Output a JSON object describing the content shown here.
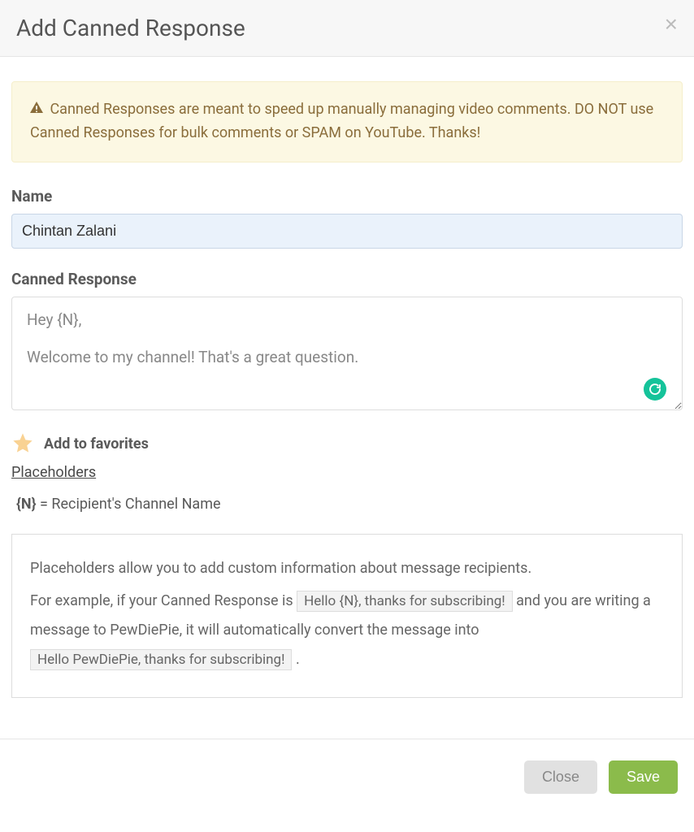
{
  "modal": {
    "title": "Add Canned Response"
  },
  "alert": {
    "text": "Canned Responses are meant to speed up manually managing video comments. DO NOT use Canned Responses for bulk comments or SPAM on YouTube. Thanks!"
  },
  "form": {
    "name_label": "Name",
    "name_value": "Chintan Zalani",
    "response_label": "Canned Response",
    "response_value": "Hey {N},\n\nWelcome to my channel! That's a great question."
  },
  "favorites": {
    "label": "Add to favorites"
  },
  "placeholders": {
    "link_label": "Placeholders",
    "token": "{N}",
    "equals": " = Recipient's Channel Name",
    "info_intro": "Placeholders allow you to add custom information about message recipients.",
    "info_example_prefix": "For example, if your Canned Response is ",
    "info_example_code1": "Hello {N}, thanks for subscribing!",
    "info_example_mid": " and you are writing a message to PewDiePie, it will automatically convert the message into ",
    "info_example_code2": "Hello PewDiePie, thanks for subscribing!",
    "info_example_suffix": " ."
  },
  "footer": {
    "close_label": "Close",
    "save_label": "Save"
  }
}
